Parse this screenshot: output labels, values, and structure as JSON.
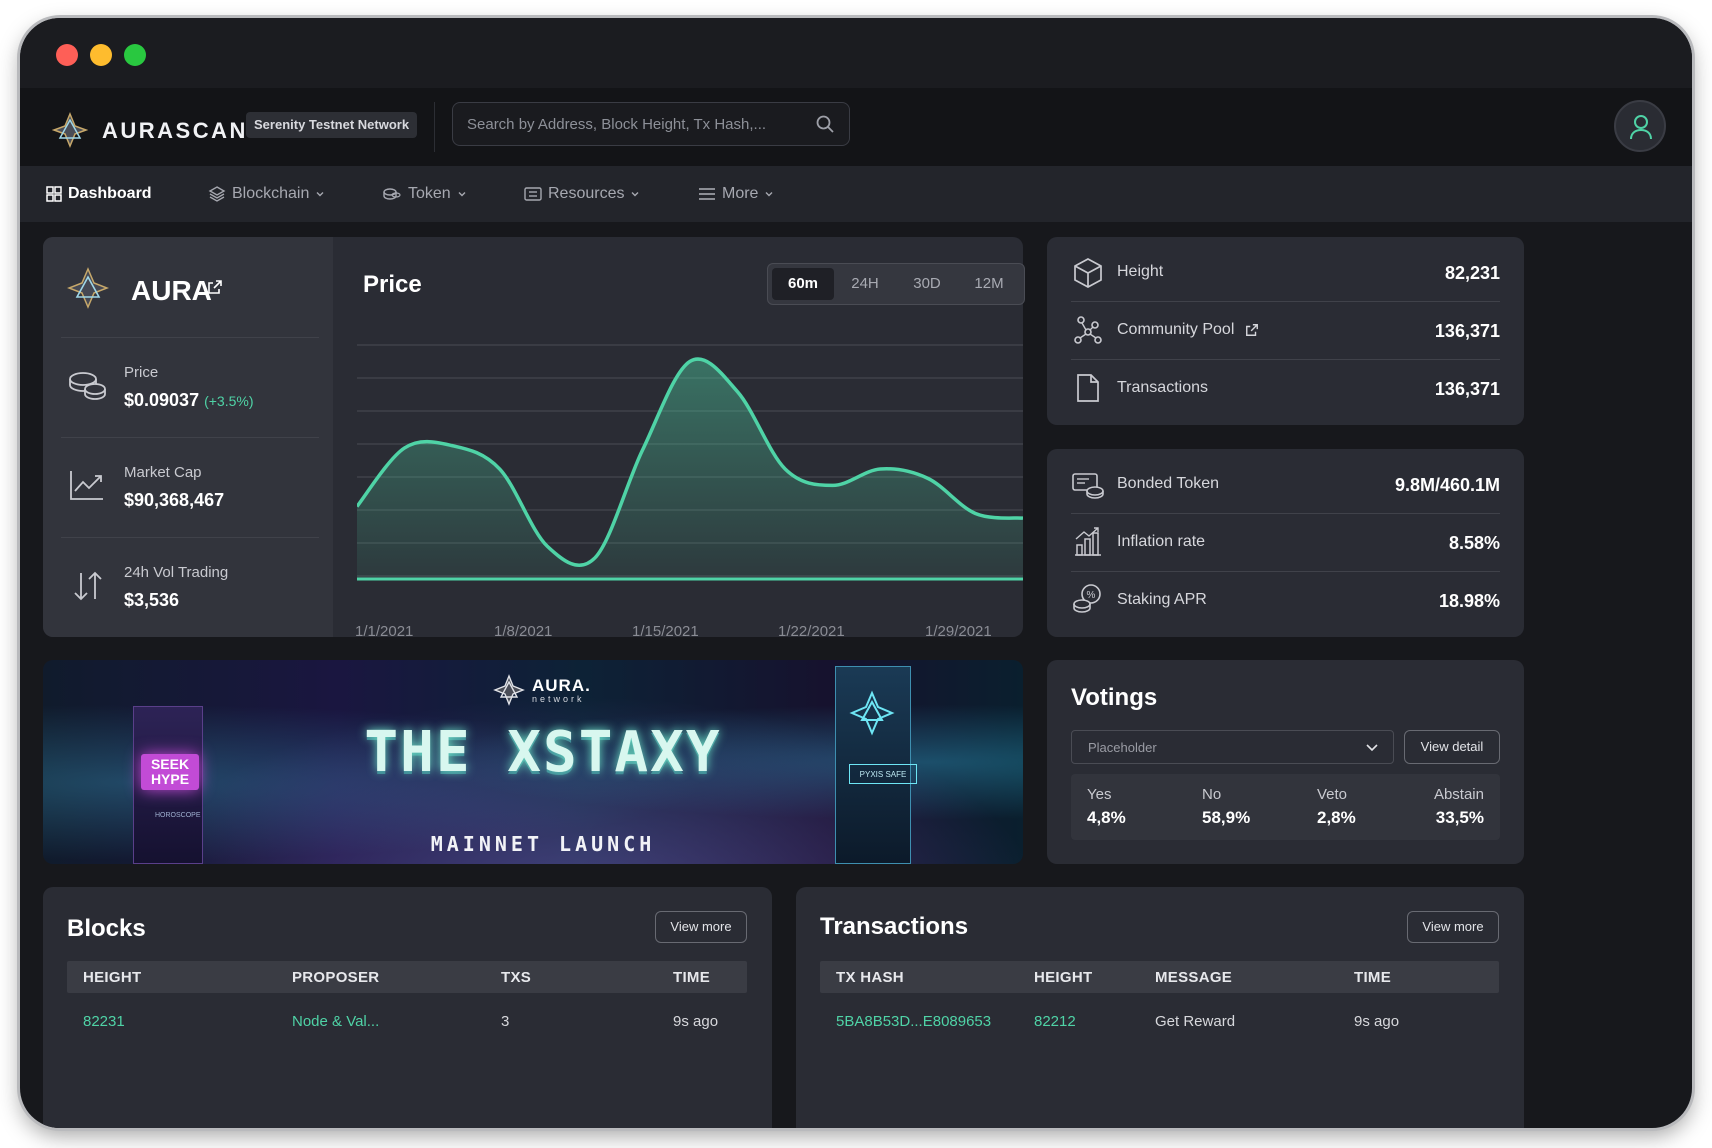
{
  "app": {
    "brand": "AURASCAN",
    "network": "Serenity Testnet Network",
    "search_placeholder": "Search by Address, Block Height, Tx Hash,..."
  },
  "nav": {
    "items": [
      {
        "label": "Dashboard"
      },
      {
        "label": "Blockchain"
      },
      {
        "label": "Token"
      },
      {
        "label": "Resources"
      },
      {
        "label": "More"
      }
    ]
  },
  "coin": {
    "name": "AURA",
    "price_label": "Price",
    "price_value": "$0.09037",
    "price_change": "(+3.5%)",
    "mcap_label": "Market Cap",
    "mcap_value": "$90,368,467",
    "vol_label": "24h Vol Trading",
    "vol_value": "$3,536"
  },
  "chart": {
    "title": "Price",
    "tabs": [
      "60m",
      "24H",
      "30D",
      "12M"
    ],
    "active_tab": "60m"
  },
  "chart_data": {
    "type": "area",
    "title": "Price",
    "x_tick_labels": [
      "1/1/2021",
      "1/8/2021",
      "1/15/2021",
      "1/22/2021",
      "1/29/2021"
    ],
    "series": [
      {
        "values": [
          0.31,
          0.56,
          0.57,
          0.47,
          0.14,
          0.09,
          0.55,
          0.93,
          0.8,
          0.47,
          0.4,
          0.47,
          0.43,
          0.28,
          0.26
        ]
      }
    ],
    "x": [
      "12/31/2020",
      "1/2/2021",
      "1/4/2021",
      "1/6/2021",
      "1/9/2021",
      "1/11/2021",
      "1/13/2021",
      "1/15/2021",
      "1/17/2021",
      "1/19/2021",
      "1/21/2021",
      "1/24/2021",
      "1/26/2021",
      "1/28/2021",
      "1/30/2021"
    ],
    "ylim": [
      0,
      1
    ],
    "grid": true,
    "color": "#4fd3a6"
  },
  "stats1": [
    {
      "label": "Height",
      "value": "82,231",
      "icon": "cube-icon"
    },
    {
      "label": "Community Pool",
      "value": "136,371",
      "icon": "network-icon"
    },
    {
      "label": "Transactions",
      "value": "136,371",
      "icon": "document-icon"
    }
  ],
  "stats2": [
    {
      "label": "Bonded Token",
      "value": "9.8M/460.1M",
      "icon": "bonded-icon"
    },
    {
      "label": "Inflation rate",
      "value": "8.58%",
      "icon": "bar-chart-icon"
    },
    {
      "label": "Staking APR",
      "value": "18.98%",
      "icon": "staking-icon"
    }
  ],
  "banner": {
    "brand": "AURA.",
    "brand_sub": "network",
    "line1": "THE XSTAXY",
    "line2": "MAINNET LAUNCH",
    "sign1": "SEEK HYPE",
    "sign2": "HOROSCOPE",
    "sign3": "PYXIS SAFE"
  },
  "votings": {
    "title": "Votings",
    "select_placeholder": "Placeholder",
    "detail_button": "View detail",
    "options": [
      {
        "label": "Yes",
        "value": "4,8%"
      },
      {
        "label": "No",
        "value": "58,9%"
      },
      {
        "label": "Veto",
        "value": "2,8%"
      },
      {
        "label": "Abstain",
        "value": "33,5%"
      }
    ]
  },
  "blocks": {
    "title": "Blocks",
    "view_more": "View more",
    "headers": [
      "HEIGHT",
      "PROPOSER",
      "TXS",
      "TIME"
    ],
    "rows": [
      {
        "height": "82231",
        "proposer": "Node & Val...",
        "txs": "3",
        "time": "9s ago"
      }
    ]
  },
  "transactions": {
    "title": "Transactions",
    "view_more": "View more",
    "headers": [
      "TX HASH",
      "HEIGHT",
      "MESSAGE",
      "TIME"
    ],
    "rows": [
      {
        "hash": "5BA8B53D...E8089653",
        "height": "82212",
        "message": "Get Reward",
        "time": "9s ago"
      }
    ]
  }
}
